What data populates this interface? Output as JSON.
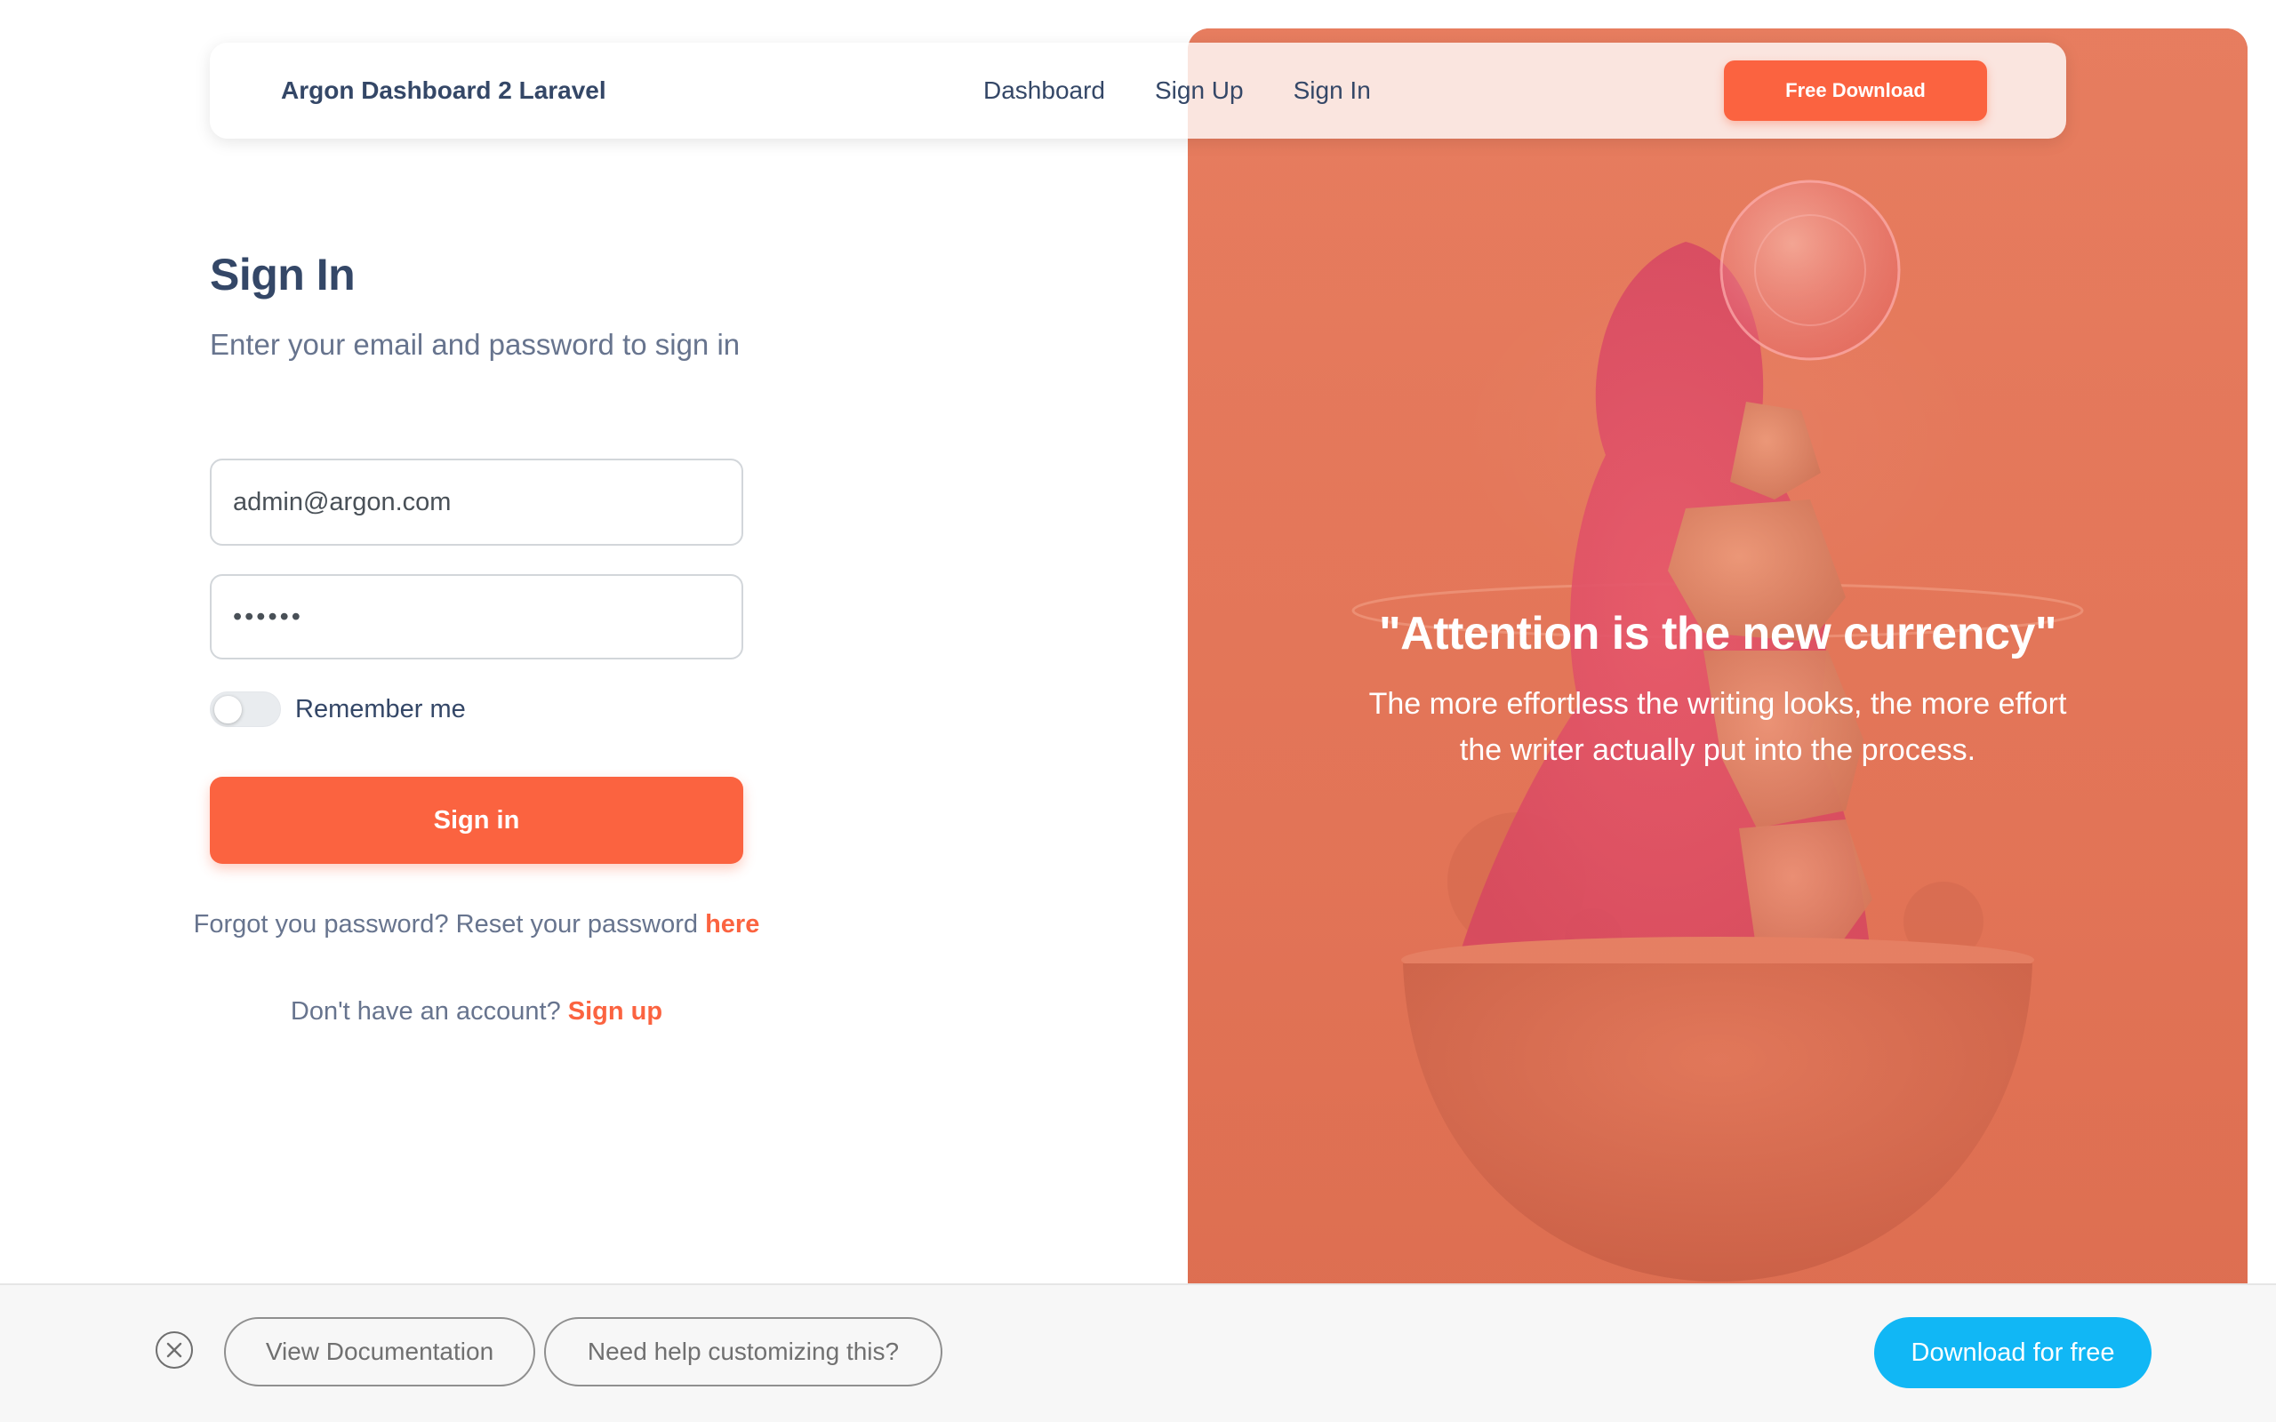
{
  "navbar": {
    "brand": "Argon Dashboard 2 Laravel",
    "links": [
      "Dashboard",
      "Sign Up",
      "Sign In"
    ],
    "cta_label": "Free Download"
  },
  "signin": {
    "title": "Sign In",
    "subtitle": "Enter your email and password to sign in",
    "email_value": "admin@argon.com",
    "password_masked": "••••••",
    "remember_label": "Remember me",
    "remember_checked": false,
    "button_label": "Sign in",
    "forgot_text": "Forgot you password? Reset your password ",
    "forgot_link": "here",
    "signup_text": "Don't have an account? ",
    "signup_link": "Sign up"
  },
  "illustration": {
    "quote_title": "\"Attention is the new currency\"",
    "quote_text": "The more effortless the writing looks, the more effort the writer actually put into the process."
  },
  "bottom_bar": {
    "docs_label": "View Documentation",
    "help_label": "Need help customizing this?",
    "download_label": "Download for free"
  },
  "colors": {
    "accent": "#fb6340",
    "text_dark": "#344767",
    "text_muted": "#67748e",
    "download_blue": "#11b7f5"
  },
  "icons": {
    "close": "close-circle-icon"
  }
}
